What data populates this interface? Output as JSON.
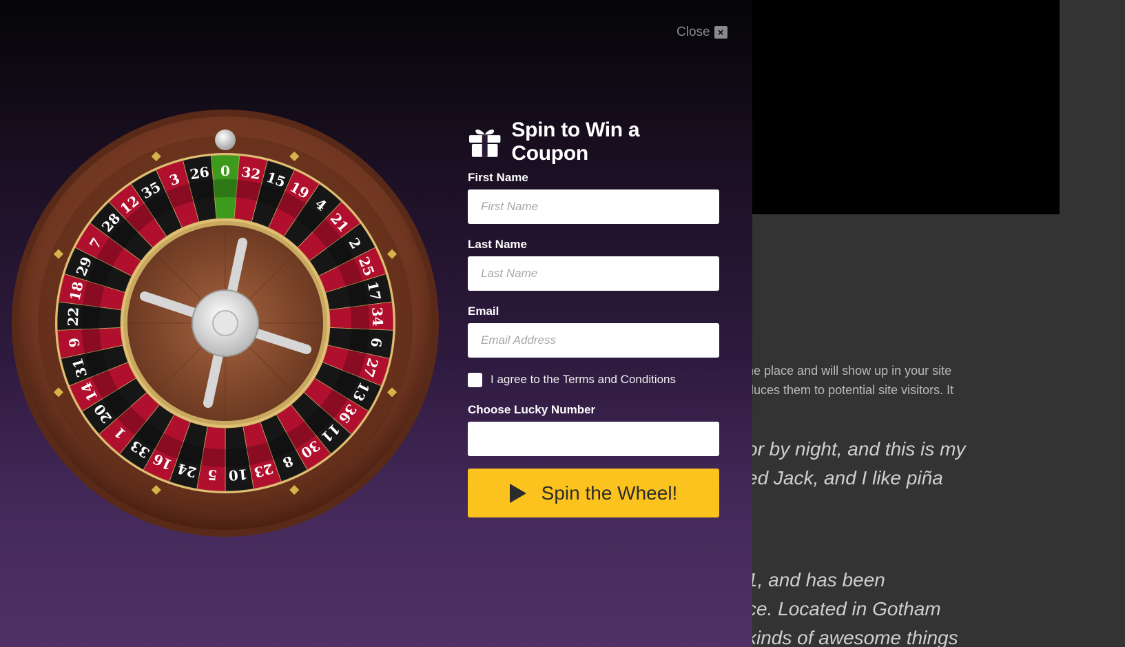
{
  "background_page": {
    "lines": [
      "ne place and will show up in your site",
      "duces them to potential site visitors. It"
    ],
    "quotes": [
      "or by night, and this is my",
      "ed Jack, and I like piña",
      "1, and has been",
      "ce. Located in Gotham",
      "kinds of awesome things"
    ]
  },
  "popup": {
    "close_label": "Close",
    "close_icon": "×",
    "title": "Spin to Win a Coupon",
    "fields": {
      "first_name": {
        "label": "First Name",
        "placeholder": "First Name",
        "value": ""
      },
      "last_name": {
        "label": "Last Name",
        "placeholder": "Last Name",
        "value": ""
      },
      "email": {
        "label": "Email",
        "placeholder": "Email Address",
        "value": ""
      },
      "lucky_number": {
        "label": "Choose Lucky Number",
        "value": ""
      }
    },
    "terms_label": "I agree to the Terms and Conditions",
    "terms_checked": false,
    "spin_button_label": "Spin the Wheel!"
  },
  "wheel": {
    "numbers": [
      "0",
      "32",
      "15",
      "19",
      "4",
      "21",
      "2",
      "25",
      "17",
      "34",
      "6",
      "27",
      "13",
      "36",
      "11",
      "30",
      "8",
      "23",
      "10",
      "5",
      "24",
      "16",
      "33",
      "1",
      "20",
      "14",
      "31",
      "9",
      "22",
      "18",
      "29",
      "7",
      "28",
      "12",
      "35",
      "3",
      "26"
    ],
    "colors": {
      "red": "#b0102e",
      "black": "#161616",
      "green": "#3c9a1c",
      "wood": "#8a4a2b",
      "gold": "#d6b24a"
    }
  },
  "colors": {
    "accent": "#fcc31f",
    "popup_gradient_top": "#050507",
    "popup_gradient_bottom": "#4f3166",
    "page_background": "#333333"
  }
}
